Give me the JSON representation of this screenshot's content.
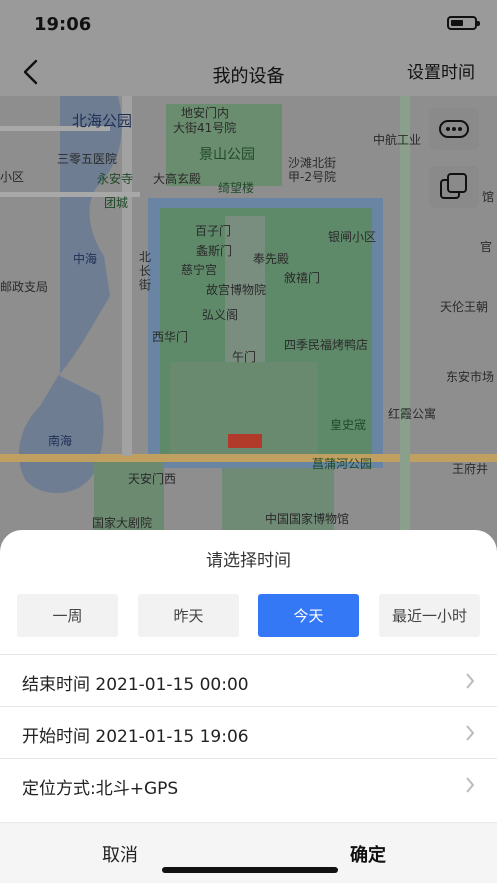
{
  "status": {
    "time": "19:06"
  },
  "nav": {
    "title": "我的设备",
    "right_action": "设置时间"
  },
  "map": {
    "labels": [
      {
        "text": "北海公园",
        "tone": "b"
      },
      {
        "text": "地安门内",
        "tone": ""
      },
      {
        "text": "大街41号院",
        "tone": ""
      },
      {
        "text": "景山公园",
        "tone": "g"
      },
      {
        "text": "三零五医院",
        "tone": ""
      },
      {
        "text": "永安寺",
        "tone": "g"
      },
      {
        "text": "大高玄殿",
        "tone": ""
      },
      {
        "text": "绮望楼",
        "tone": "g"
      },
      {
        "text": "沙滩北街",
        "tone": ""
      },
      {
        "text": "甲-2号院",
        "tone": ""
      },
      {
        "text": "中航工业",
        "tone": ""
      },
      {
        "text": "团城",
        "tone": "g"
      },
      {
        "text": "百子门",
        "tone": ""
      },
      {
        "text": "银闸小区",
        "tone": ""
      },
      {
        "text": "中海",
        "tone": "b"
      },
      {
        "text": "北长街",
        "tone": ""
      },
      {
        "text": "螽斯门",
        "tone": ""
      },
      {
        "text": "奉先殿",
        "tone": ""
      },
      {
        "text": "慈宁宫",
        "tone": ""
      },
      {
        "text": "敘禧门",
        "tone": ""
      },
      {
        "text": "故宫博物院",
        "tone": ""
      },
      {
        "text": "弘义阁",
        "tone": ""
      },
      {
        "text": "天伦王朝",
        "tone": ""
      },
      {
        "text": "西华门",
        "tone": ""
      },
      {
        "text": "四季民福烤鸭店",
        "tone": ""
      },
      {
        "text": "午门",
        "tone": ""
      },
      {
        "text": "东安市场",
        "tone": ""
      },
      {
        "text": "红霞公寓",
        "tone": ""
      },
      {
        "text": "南海",
        "tone": "b"
      },
      {
        "text": "皇史宬",
        "tone": "g"
      },
      {
        "text": "菖蒲河公园",
        "tone": "g"
      },
      {
        "text": "天安门西",
        "tone": ""
      },
      {
        "text": "王府井",
        "tone": ""
      },
      {
        "text": "中国国家博物馆",
        "tone": ""
      },
      {
        "text": "国家大剧院",
        "tone": ""
      },
      {
        "text": "小区",
        "tone": ""
      },
      {
        "text": "邮政支局",
        "tone": ""
      },
      {
        "text": "官",
        "tone": ""
      },
      {
        "text": "馆",
        "tone": ""
      }
    ]
  },
  "sheet": {
    "title": "请选择时间",
    "options": [
      "一周",
      "昨天",
      "今天",
      "最近一小时"
    ],
    "selected_option": "今天",
    "rows": [
      "结束时间 2021-01-15 00:00",
      "开始时间 2021-01-15 19:06",
      "定位方式:北斗+GPS"
    ],
    "cancel_label": "取消",
    "confirm_label": "确定"
  }
}
